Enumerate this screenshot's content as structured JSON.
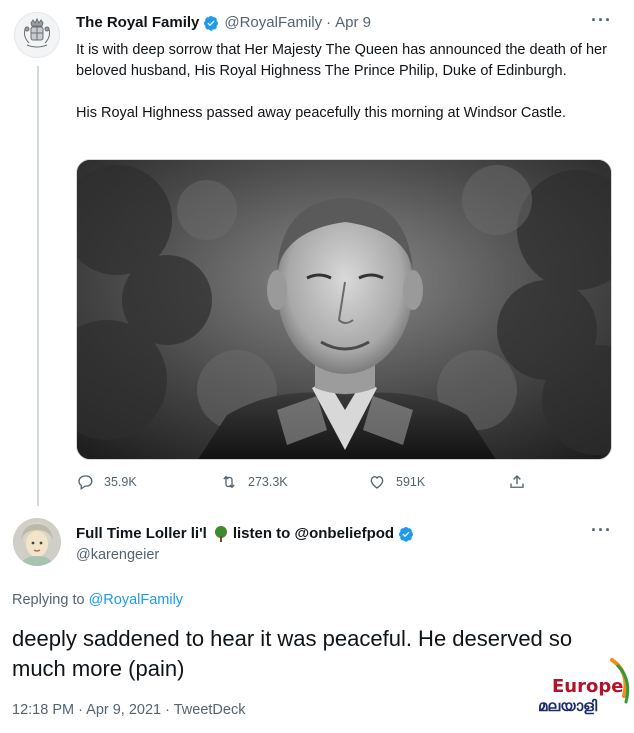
{
  "original_tweet": {
    "name": "The Royal Family",
    "handle": "@RoyalFamily",
    "separator": "·",
    "date": "Apr 9",
    "more": "···",
    "paragraphs": [
      "It is with deep sorrow that Her Majesty The Queen has announced the death of her beloved husband, His Royal Highness The Prince Philip, Duke of Edinburgh.",
      "His Royal Highness passed away peacefully this morning at Windsor Castle."
    ],
    "stats": {
      "replies": "35.9K",
      "retweets": "273.3K",
      "likes": "591K"
    }
  },
  "reply_tweet": {
    "name_part1": "Full Time Loller li'l",
    "name_part2": "listen to @onbeliefpod",
    "handle": "@karengeier",
    "more": "···",
    "replying_prefix": "Replying to",
    "replying_to": "@RoyalFamily",
    "text": "deeply saddened to hear it was peaceful. He deserved so much more (pain)",
    "meta": "12:18 PM · Apr 9, 2021 · TweetDeck"
  },
  "watermark": {
    "latin": "Europe",
    "malayalam": "മലയാളി"
  },
  "colors": {
    "text": "#0f1419",
    "muted": "#536471",
    "link": "#1d9bf0",
    "verified": "#1d9bf0"
  },
  "icons": [
    "royal-crest-icon",
    "verified-badge-icon",
    "reply-icon",
    "retweet-icon",
    "like-icon",
    "share-icon",
    "tree-emoji-icon",
    "more-icon"
  ]
}
